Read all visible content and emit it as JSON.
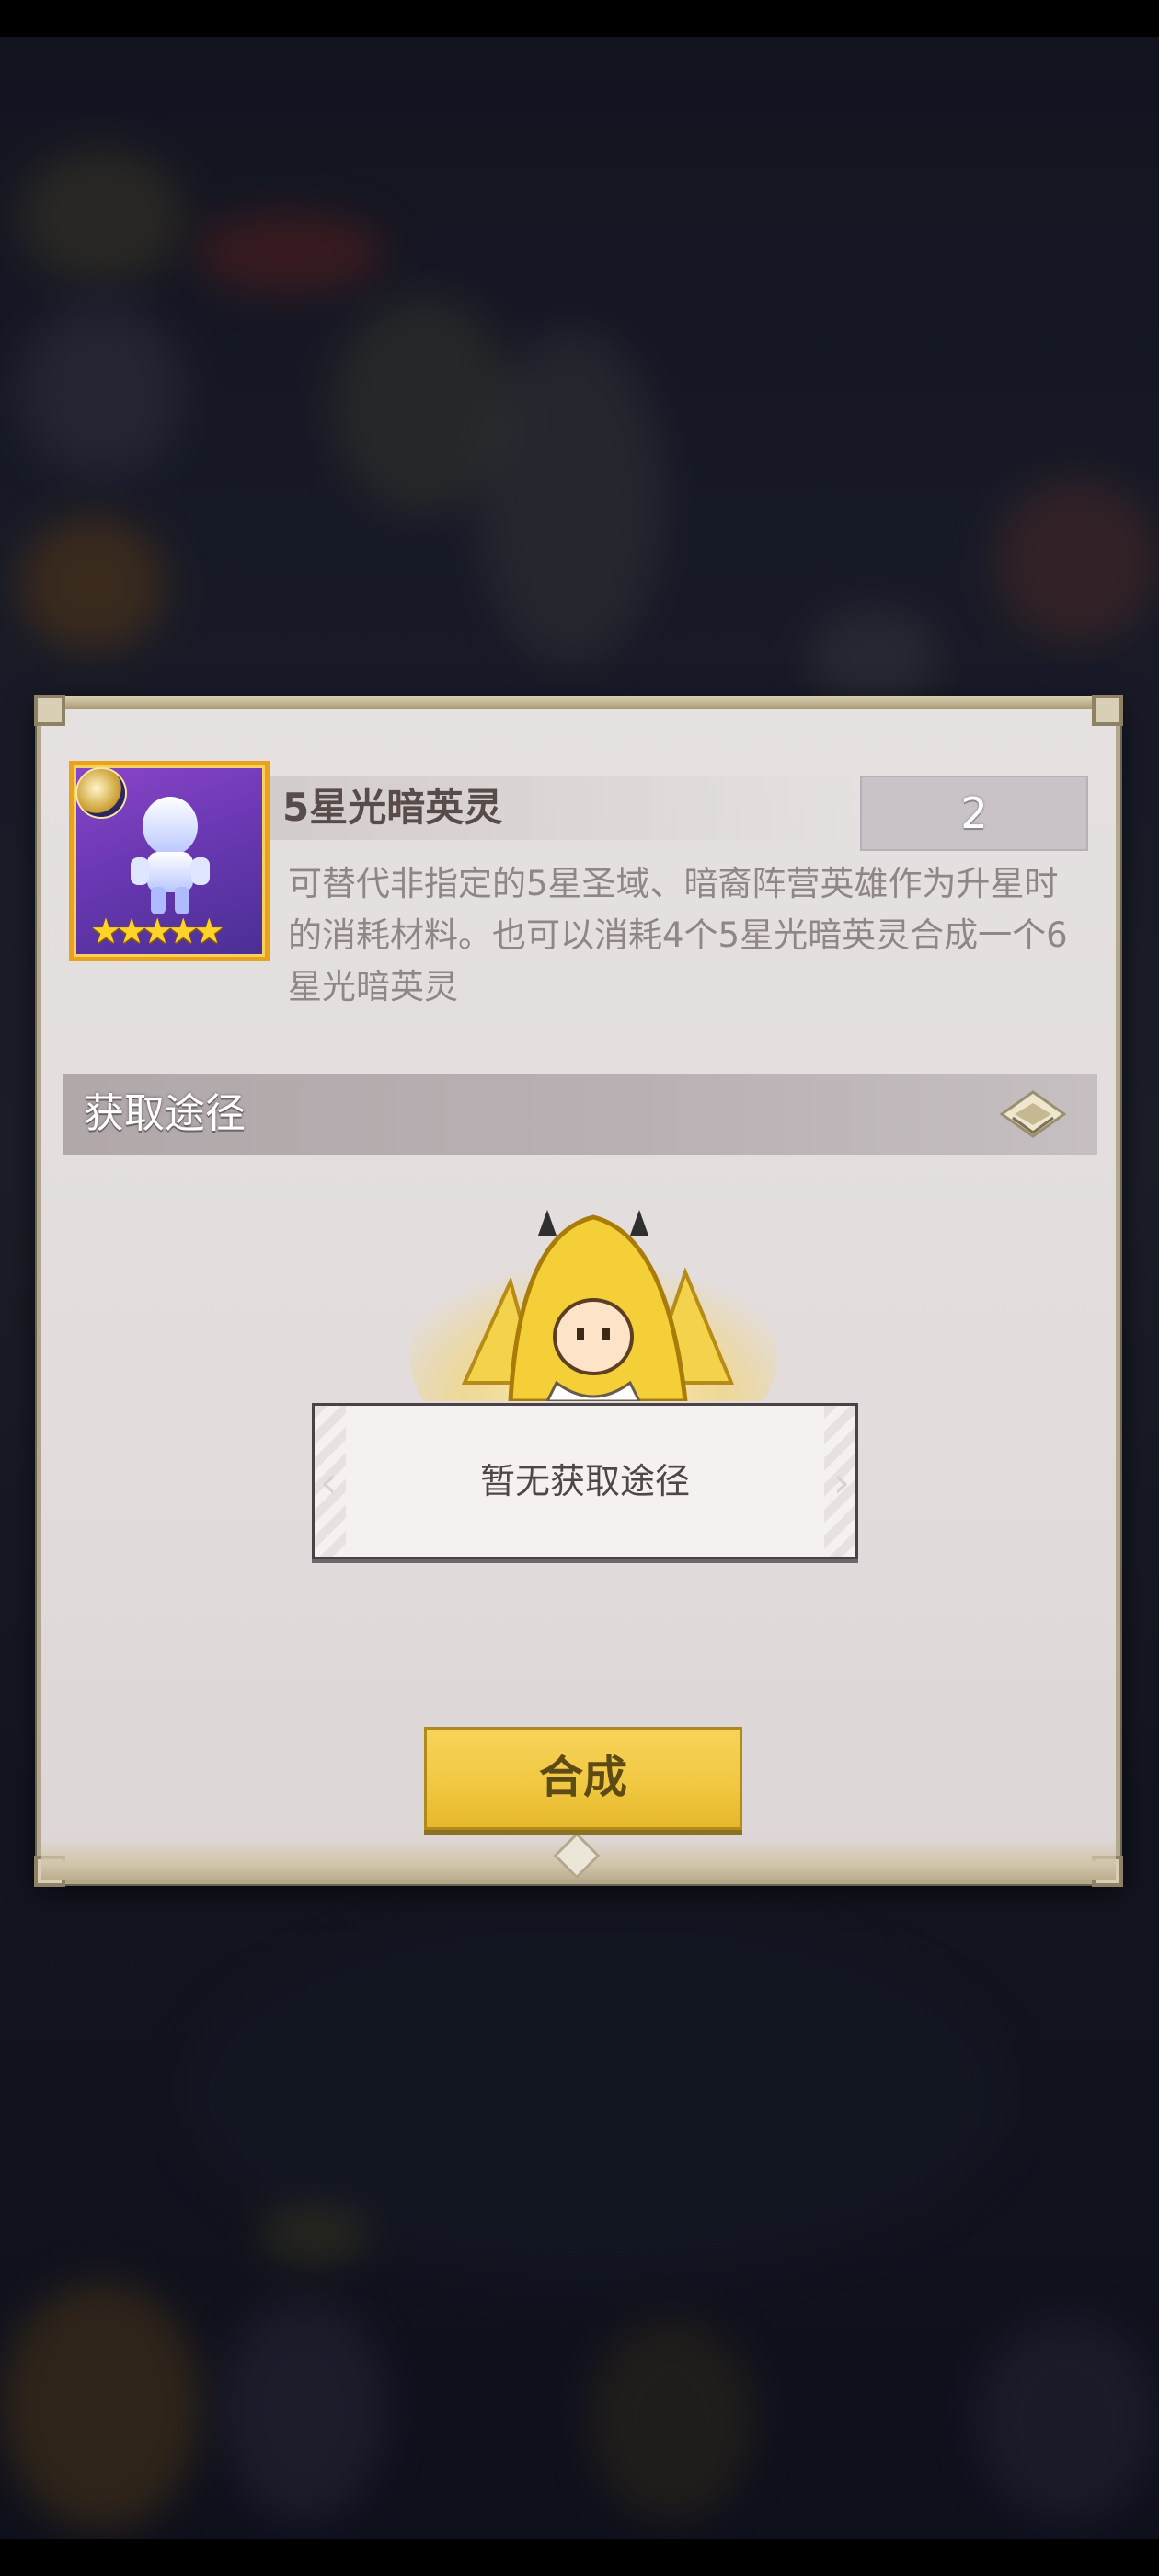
{
  "item": {
    "name": "5星光暗英灵",
    "count": "2",
    "stars": "★★★★★",
    "description": "可替代非指定的5星圣域、暗裔阵营英雄作为升星时的消耗材料。也可以消耗4个5星光暗英灵合成一个6星光暗英灵"
  },
  "acquire": {
    "section_title": "获取途径",
    "empty_text": "暂无获取途径"
  },
  "actions": {
    "synth_label": "合成"
  },
  "colors": {
    "accent_gold": "#f0c740",
    "icon_frame": "#e8a21c",
    "panel_bg": "#e4dede",
    "header_bg": "#b1a8aa"
  }
}
